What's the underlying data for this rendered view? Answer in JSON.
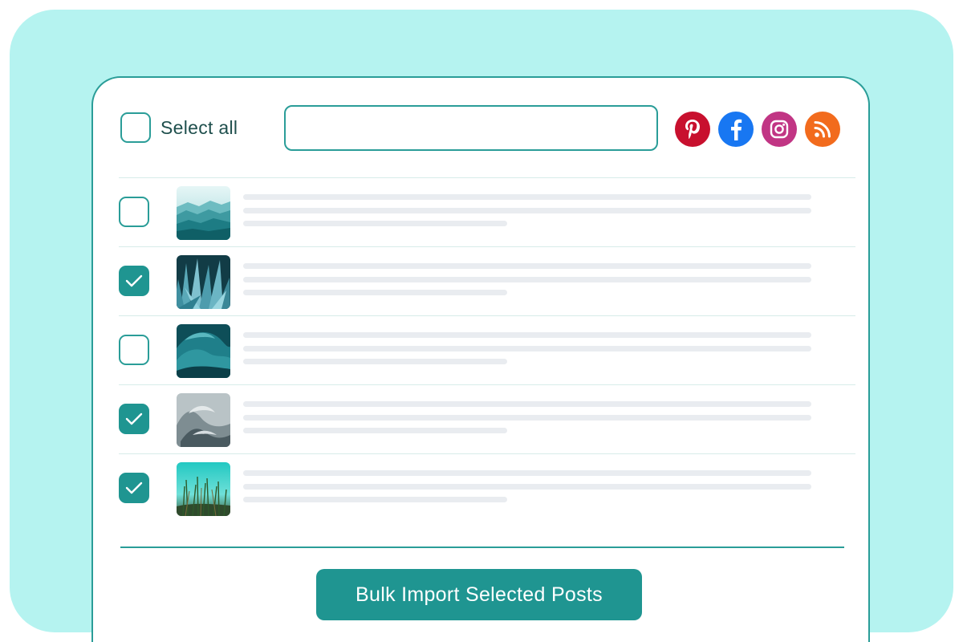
{
  "toolbar": {
    "select_all_label": "Select all",
    "select_all_checked": false,
    "search_value": "",
    "social_icons": [
      {
        "name": "pinterest-icon",
        "color": "#c8102e"
      },
      {
        "name": "facebook-icon",
        "color": "#1877f2"
      },
      {
        "name": "instagram-icon",
        "color": "#c13584"
      },
      {
        "name": "rss-icon",
        "color": "#f26b1d"
      }
    ]
  },
  "posts": [
    {
      "checked": false,
      "thumbnail": "teal-mountains"
    },
    {
      "checked": true,
      "thumbnail": "agave-leaves"
    },
    {
      "checked": false,
      "thumbnail": "ocean-wave"
    },
    {
      "checked": true,
      "thumbnail": "grey-silk"
    },
    {
      "checked": true,
      "thumbnail": "grass-sky"
    }
  ],
  "footer": {
    "import_button_label": "Bulk Import Selected Posts"
  },
  "colors": {
    "accent": "#1f9591",
    "border": "#2a9d98",
    "background": "#b5f3f0",
    "placeholder_line": "#e9ecf0"
  }
}
